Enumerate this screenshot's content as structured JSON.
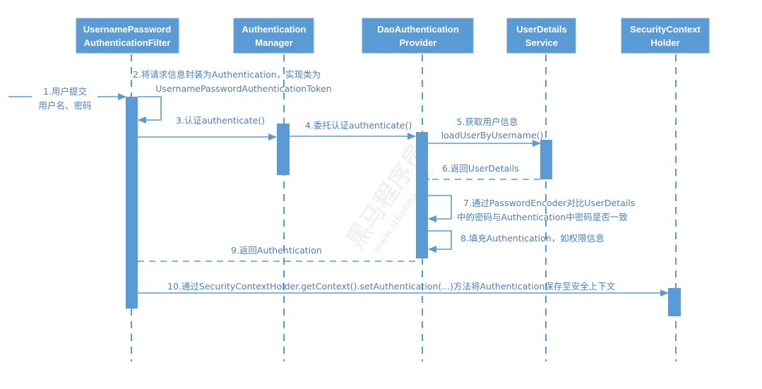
{
  "diagram_type": "sequence",
  "colors": {
    "lifeline": "#5b9bd5",
    "header_fill": "#5b9bd5",
    "label_text": "#4a7fc0"
  },
  "participants": [
    {
      "line1": "UsernamePassword",
      "line2": "AuthenticationFilter"
    },
    {
      "line1": "Authentication",
      "line2": "Manager"
    },
    {
      "line1": "DaoAuthentication",
      "line2": "Provider"
    },
    {
      "line1": "UserDetails",
      "line2": "Service"
    },
    {
      "line1": "SecurityContext",
      "line2": "Holder"
    }
  ],
  "messages": [
    {
      "line1": "1.用户提交",
      "line2": "用户名、密码"
    },
    {
      "line1": "2.将请求信息封装为Authentication，实现类为",
      "line2": "UsernamePasswordAuthenticationToken"
    },
    {
      "line1": "3.认证authenticate()"
    },
    {
      "line1": "4.委托认证authenticate()"
    },
    {
      "line1": "5.获取用户信息",
      "line2": "loadUserByUsername()"
    },
    {
      "line1": "6.返回UserDetails"
    },
    {
      "line1": "7.通过PasswordEncoder对比UserDetails",
      "line2": "中的密码与Authentication中密码是否一致"
    },
    {
      "line1": "8.填充Authentication，如权限信息"
    },
    {
      "line1": "9.返回Authentication"
    },
    {
      "line1": "10.通过SecurityContextHolder.getContext().setAuthentication(...)方法将Authentication保存至安全上下文"
    }
  ],
  "watermark": {
    "text": "黑马程序员",
    "subtext": "www.itheima.com"
  }
}
